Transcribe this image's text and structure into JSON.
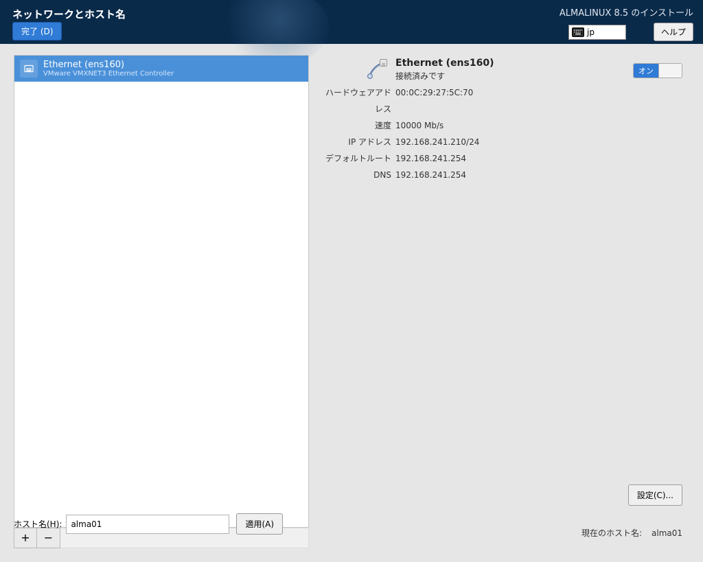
{
  "header": {
    "title": "ネットワークとホスト名",
    "done_label": "完了 (D)",
    "install_label": "ALMALINUX 8.5 のインストール",
    "kb_layout": "jp",
    "help_label": "ヘルプ"
  },
  "nic_list": {
    "items": [
      {
        "title": "Ethernet (ens160)",
        "subtitle": "VMware VMXNET3 Ethernet Controller"
      }
    ]
  },
  "nic_toolbar": {
    "add": "+",
    "remove": "−"
  },
  "detail": {
    "title": "Ethernet (ens160)",
    "status": "接続済みです",
    "toggle_on": "オン",
    "rows": [
      {
        "label": "ハードウェアアドレス",
        "value": "00:0C:29:27:5C:70"
      },
      {
        "label": "速度",
        "value": "10000 Mb/s"
      },
      {
        "label": "IP アドレス",
        "value": "192.168.241.210/24"
      },
      {
        "label": "デフォルトルート",
        "value": "192.168.241.254"
      },
      {
        "label": "DNS",
        "value": "192.168.241.254"
      }
    ],
    "config_label": "設定(C)..."
  },
  "hostname": {
    "label": "ホスト名(H):",
    "value": "alma01",
    "apply_label": "適用(A)",
    "current_label": "現在のホスト名:",
    "current_value": "alma01"
  }
}
